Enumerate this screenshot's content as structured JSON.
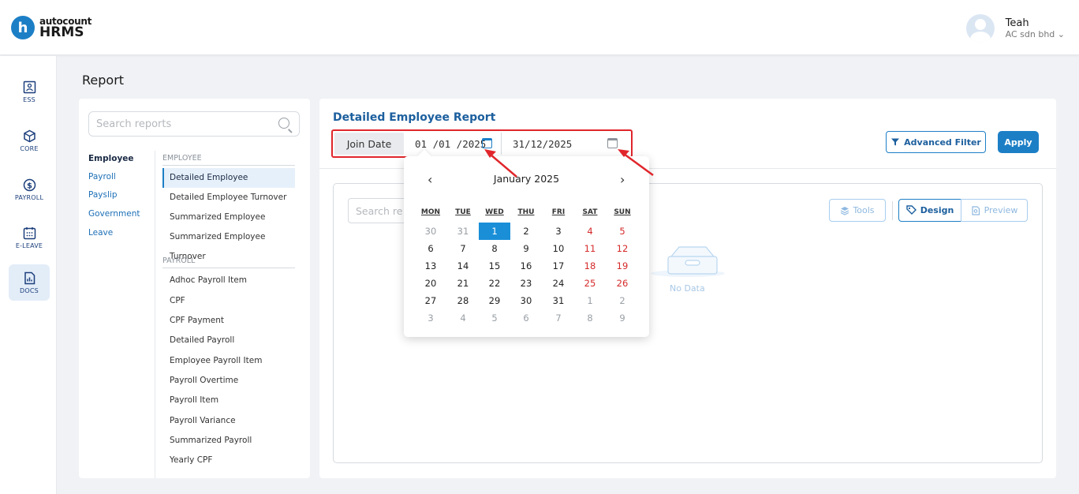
{
  "brand": {
    "top": "autocount",
    "bottom": "HRMS"
  },
  "user": {
    "name": "Teah",
    "company": "AC sdn bhd"
  },
  "colors": {
    "primary": "#1c7fc6",
    "highlight": "#e0262c"
  },
  "nav": [
    {
      "label": "ESS",
      "icon": "ess-icon"
    },
    {
      "label": "CORE",
      "icon": "cube-icon"
    },
    {
      "label": "PAYROLL",
      "icon": "dollar-icon"
    },
    {
      "label": "E-LEAVE",
      "icon": "calendar-icon"
    },
    {
      "label": "DOCS",
      "icon": "document-chart-icon"
    }
  ],
  "page_title": "Report",
  "search": {
    "placeholder": "Search reports"
  },
  "categories": [
    "Employee",
    "Payroll",
    "Payslip",
    "Government",
    "Leave"
  ],
  "sections": [
    {
      "heading": "EMPLOYEE",
      "items": [
        "Detailed Employee",
        "Detailed Employee Turnover",
        "Summarized Employee",
        "Summarized Employee Turnover"
      ]
    },
    {
      "heading": "PAYROLL",
      "items": [
        "Adhoc Payroll Item",
        "CPF",
        "CPF Payment",
        "Detailed Payroll",
        "Employee Payroll Item",
        "Payroll Overtime",
        "Payroll Item",
        "Payroll Variance",
        "Summarized Payroll",
        "Yearly CPF"
      ]
    }
  ],
  "report": {
    "title": "Detailed Employee Report",
    "filter_label": "Join Date",
    "date_from": "01 /01 /2025",
    "date_to": "31/12/2025",
    "advanced_filter": "Advanced Filter",
    "apply": "Apply"
  },
  "viewer": {
    "search_placeholder": "Search re",
    "tools": "Tools",
    "design": "Design",
    "preview": "Preview",
    "empty": "No Data"
  },
  "calendar": {
    "prev": "‹",
    "next": "›",
    "month": "January 2025",
    "weekdays": [
      "MON",
      "TUE",
      "WED",
      "THU",
      "FRI",
      "SAT",
      "SUN"
    ],
    "weeks": [
      [
        "30",
        "31",
        "1",
        "2",
        "3",
        "4",
        "5"
      ],
      [
        "6",
        "7",
        "8",
        "9",
        "10",
        "11",
        "12"
      ],
      [
        "13",
        "14",
        "15",
        "16",
        "17",
        "18",
        "19"
      ],
      [
        "20",
        "21",
        "22",
        "23",
        "24",
        "25",
        "26"
      ],
      [
        "27",
        "28",
        "29",
        "30",
        "31",
        "1",
        "2"
      ],
      [
        "3",
        "4",
        "5",
        "6",
        "7",
        "8",
        "9"
      ]
    ],
    "selected": "1"
  }
}
